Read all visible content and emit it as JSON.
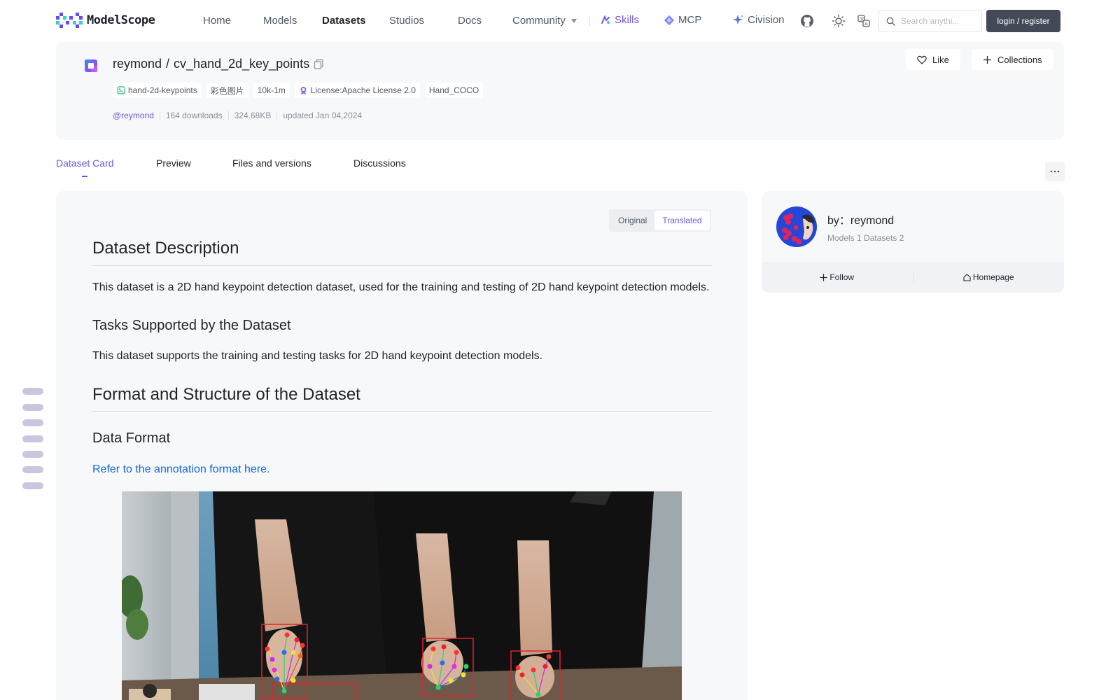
{
  "nav": {
    "brand": "ModelScope",
    "items": [
      {
        "label": "Home"
      },
      {
        "label": "Models"
      },
      {
        "label": "Datasets"
      },
      {
        "label": "Studios"
      },
      {
        "label": "Docs"
      },
      {
        "label": "Community"
      }
    ],
    "skills": "Skills",
    "mcp": "MCP",
    "civision": "Civision",
    "search_placeholder": "Search anythi...",
    "login": "login / register",
    "icons": [
      "github-icon",
      "theme-sun-icon",
      "language-icon",
      "search-icon"
    ]
  },
  "dataset": {
    "owner": "reymond",
    "slash": "/",
    "name": "cv_hand_2d_key_points",
    "tags": [
      {
        "label": "hand-2d-keypoints"
      },
      {
        "label": "彩色图片"
      },
      {
        "label": "10k-1m"
      },
      {
        "label": "License:Apache License 2.0"
      },
      {
        "label": "Hand_COCO"
      }
    ],
    "author_handle": "@reymond",
    "downloads": "164 downloads",
    "size": "324.68KB",
    "updated": "updated Jan 04,2024",
    "like": "Like",
    "collections": "Collections"
  },
  "tabs": [
    {
      "label": "Dataset Card"
    },
    {
      "label": "Preview"
    },
    {
      "label": "Files and versions"
    },
    {
      "label": "Discussions"
    }
  ],
  "card": {
    "toggle": {
      "original": "Original",
      "translated": "Translated"
    },
    "h_description": "Dataset Description",
    "p_description": "This dataset is a 2D hand keypoint detection dataset, used for the training and testing of 2D hand keypoint detection models.",
    "h_tasks": "Tasks Supported by the Dataset",
    "p_tasks": "This dataset supports the training and testing tasks for 2D hand keypoint detection models.",
    "h_format": "Format and Structure of the Dataset",
    "h_data_format": "Data Format",
    "link_annotation": "Refer to the annotation format here."
  },
  "author": {
    "by": "by：reymond",
    "models": "Models 1",
    "datasets": "Datasets 2",
    "follow": "Follow",
    "homepage": "Homepage"
  },
  "colors": {
    "accent": "#6e56e6",
    "link": "#1268d8",
    "login_bg": "#434a57",
    "card_bg": "#f7f8fa"
  }
}
